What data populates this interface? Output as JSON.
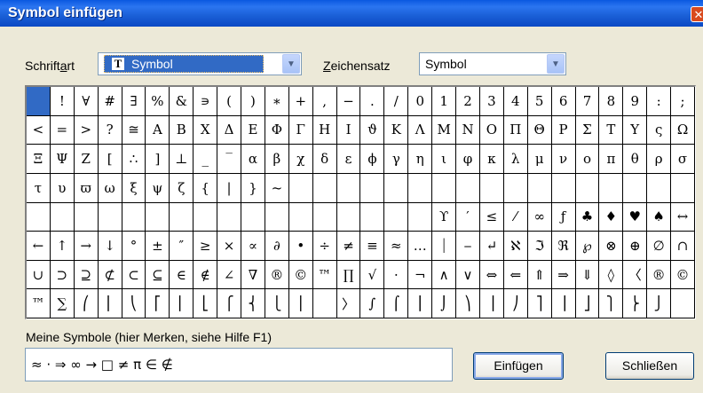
{
  "window": {
    "title": "Symbol einfügen",
    "close_glyph": "✕"
  },
  "font": {
    "label_pre": "Schrift",
    "label_acc": "a",
    "label_post": "rt",
    "icon_glyph": "T",
    "value": "Symbol",
    "arrow": "▼"
  },
  "charset": {
    "label_acc": "Z",
    "label_post": "eichensatz",
    "value": "Symbol",
    "arrow": "▼"
  },
  "grid": {
    "rows": [
      [
        " ",
        "!",
        "∀",
        "#",
        "∃",
        "%",
        "&",
        "∍",
        "(",
        ")",
        "∗",
        "+",
        ",",
        "−",
        ".",
        "/",
        "0",
        "1",
        "2",
        "3",
        "4",
        "5",
        "6",
        "7",
        "8",
        "9",
        ":",
        ";"
      ],
      [
        "<",
        "=",
        ">",
        "?",
        "≅",
        "Α",
        "Β",
        "Χ",
        "Δ",
        "Ε",
        "Φ",
        "Γ",
        "Η",
        "Ι",
        "ϑ",
        "Κ",
        "Λ",
        "Μ",
        "Ν",
        "Ο",
        "Π",
        "Θ",
        "Ρ",
        "Σ",
        "Τ",
        "Υ",
        "ς",
        "Ω"
      ],
      [
        "Ξ",
        "Ψ",
        "Ζ",
        "[",
        "∴",
        "]",
        "⊥",
        "_",
        "‾",
        "α",
        "β",
        "χ",
        "δ",
        "ε",
        "ϕ",
        "γ",
        "η",
        "ι",
        "φ",
        "κ",
        "λ",
        "μ",
        "ν",
        "ο",
        "π",
        "θ",
        "ρ",
        "σ"
      ],
      [
        "τ",
        "υ",
        "ϖ",
        "ω",
        "ξ",
        "ψ",
        "ζ",
        "{",
        "|",
        "}",
        "~",
        "",
        "",
        "",
        "",
        "",
        "",
        "",
        "",
        "",
        "",
        "",
        "",
        "",
        "",
        "",
        "",
        ""
      ],
      [
        "",
        "",
        "",
        "",
        "",
        "",
        "",
        "",
        "",
        "",
        "",
        "",
        "",
        "",
        "",
        "",
        "",
        "ϒ",
        "′",
        "≤",
        "⁄",
        "∞",
        "ƒ",
        "♣",
        "♦",
        "♥",
        "♠",
        "↔"
      ],
      [
        "←",
        "↑",
        "→",
        "↓",
        "°",
        "±",
        "″",
        "≥",
        "×",
        "∝",
        "∂",
        "•",
        "÷",
        "≠",
        "≡",
        "≈",
        "…",
        "⏐",
        "⎯",
        "↵",
        "ℵ",
        "ℑ",
        "ℜ",
        "℘",
        "⊗",
        "⊕",
        "∅",
        "∩"
      ],
      [
        "∪",
        "⊃",
        "⊇",
        "⊄",
        "⊂",
        "⊆",
        "∈",
        "∉",
        "∠",
        "∇",
        "®",
        "©",
        "™",
        "∏",
        "√",
        "⋅",
        "¬",
        "∧",
        "∨",
        "⇔",
        "⇐",
        "⇑",
        "⇒",
        "⇓",
        "◊",
        "〈",
        "®",
        "©"
      ],
      [
        "™",
        "∑",
        "⎛",
        "⎜",
        "⎝",
        "⎡",
        "⎢",
        "⎣",
        "⎧",
        "⎨",
        "⎩",
        "⎪",
        "",
        "〉",
        "∫",
        "⌠",
        "⎮",
        "⌡",
        "⎞",
        "⎟",
        "⎠",
        "⎤",
        "⎥",
        "⎦",
        "⎫",
        "⎬",
        "⎭",
        ""
      ]
    ]
  },
  "my_symbols": {
    "label": "Meine Symbole  (hier Merken, siehe Hilfe F1)",
    "value": "≈ · ⇒ ∞  → □ ≠ π ∈ ∉"
  },
  "buttons": {
    "insert": "Einfügen",
    "close": "Schließen"
  }
}
